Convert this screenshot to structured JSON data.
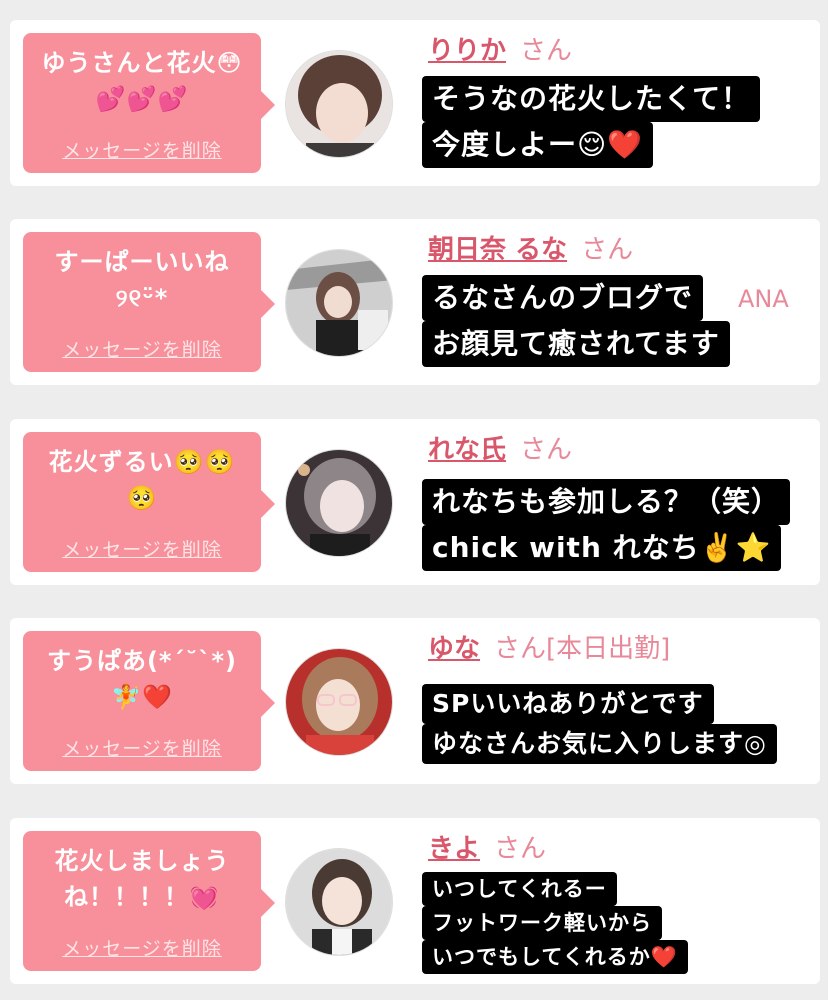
{
  "delete_label": "メッセージを削除",
  "honorific": "さん",
  "colors": {
    "bubble": "#f7909a",
    "name": "#d9576b",
    "background": "#ededed"
  },
  "messages": [
    {
      "bubble_text": "ゆうさんと花火😳\n💕💕💕",
      "name": "りりか",
      "honorific": "さん",
      "caption": [
        "そうなの花火したくて！",
        "今度しよー😌❤️"
      ],
      "avatar_color": "#6b4e44"
    },
    {
      "bubble_text": "すーぱーいいね\n୨୧ᵕ̈*",
      "name": "朝日奈 るな",
      "honorific": "さん",
      "caption": [
        "るなさんのブログで",
        "お顔見て癒されてます"
      ],
      "stray_text": "ANA",
      "avatar_color": "#8a8a8a"
    },
    {
      "bubble_text": "花火ずるい🥺🥺\n🥺",
      "name": "れな氏",
      "honorific": "さん",
      "caption": [
        "れなちも参加しる？（笑）",
        "chick with れなち✌️⭐"
      ],
      "avatar_color": "#4a4040"
    },
    {
      "bubble_text": "すうぱあ(*´˘`*)\n🧚❤️",
      "name": "ゆな",
      "honorific": "さん[本日出勤]",
      "caption": [
        "SPいいねありがとです",
        "ゆなさんお気に入りします◎"
      ],
      "avatar_color": "#c0392b"
    },
    {
      "bubble_text": "花火しましょう\nね！！！！💓",
      "name": "きよ",
      "honorific": "さん",
      "caption": [
        "いつしてくれるー",
        "フットワーク軽いから",
        "いつでもしてくれるか❤️"
      ],
      "avatar_color": "#3a3a3a"
    }
  ]
}
